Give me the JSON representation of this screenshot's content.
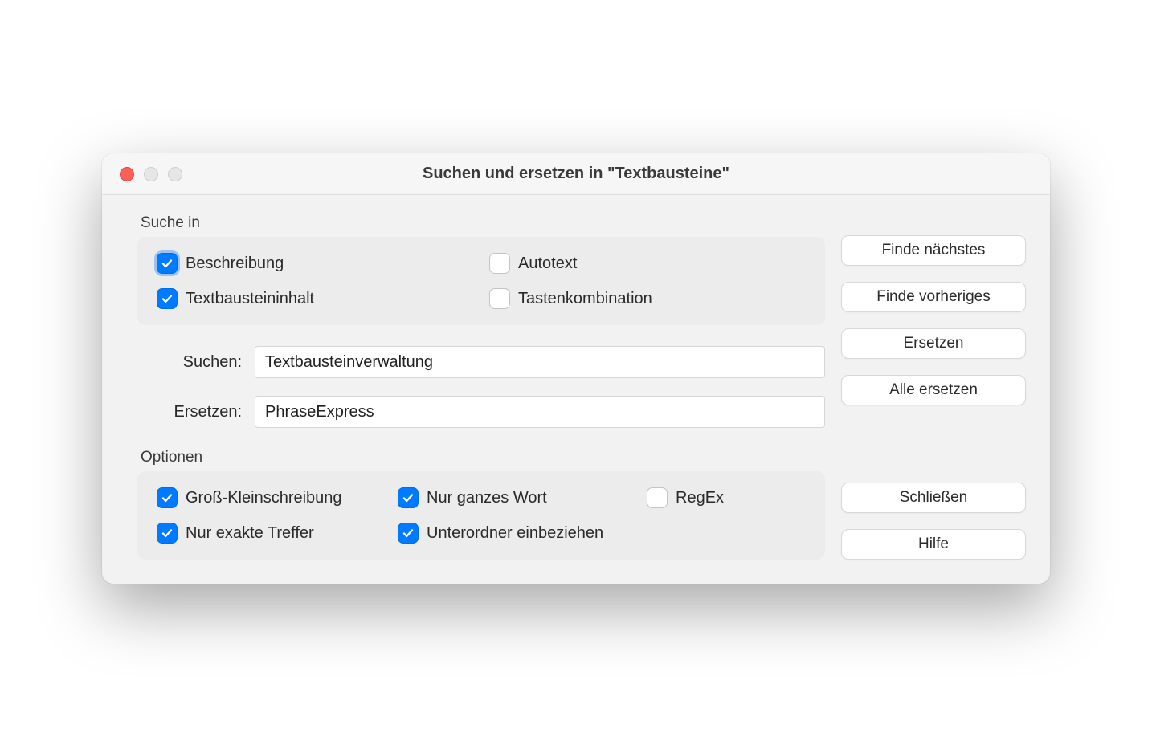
{
  "window": {
    "title": "Suchen und ersetzen in \"Textbausteine\""
  },
  "searchIn": {
    "label": "Suche in",
    "beschreibung": {
      "label": "Beschreibung",
      "checked": true
    },
    "textbausteininhalt": {
      "label": "Textbausteininhalt",
      "checked": true
    },
    "autotext": {
      "label": "Autotext",
      "checked": false
    },
    "tastenkombination": {
      "label": "Tastenkombination",
      "checked": false
    }
  },
  "fields": {
    "search": {
      "label": "Suchen:",
      "value": "Textbausteinverwaltung"
    },
    "replace": {
      "label": "Ersetzen:",
      "value": "PhraseExpress"
    }
  },
  "options": {
    "label": "Optionen",
    "caseSensitive": {
      "label": "Groß-Kleinschreibung",
      "checked": true
    },
    "exactOnly": {
      "label": "Nur exakte Treffer",
      "checked": true
    },
    "wholeWord": {
      "label": "Nur ganzes Wort",
      "checked": true
    },
    "includeSubfolders": {
      "label": "Unterordner einbeziehen",
      "checked": true
    },
    "regex": {
      "label": "RegEx",
      "checked": false
    }
  },
  "buttons": {
    "findNext": "Finde nächstes",
    "findPrev": "Finde vorheriges",
    "replace": "Ersetzen",
    "replaceAll": "Alle ersetzen",
    "close": "Schließen",
    "help": "Hilfe"
  }
}
